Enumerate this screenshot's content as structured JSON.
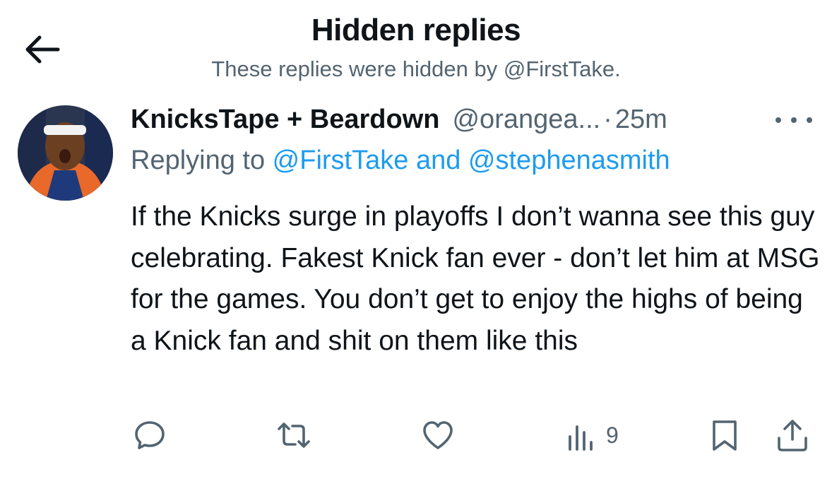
{
  "header": {
    "title": "Hidden replies",
    "subtitle": "These replies were hidden by @FirstTake.",
    "back_icon": "arrow-left-icon"
  },
  "tweet": {
    "display_name": "KnicksTape + Beardown",
    "handle": "@orangea...",
    "separator": "·",
    "time": "25m",
    "replying_prefix": "Replying to ",
    "replying_to_1": "@FirstTake",
    "replying_and": " and ",
    "replying_to_2": "@stephenasmith",
    "text": "If the Knicks surge in playoffs I don’t wanna see this guy celebrating. Fakest Knick fan ever - don’t let him at MSG for the games. You don’t get to enjoy the highs of being a Knick fan and shit on them like this",
    "views": "9"
  },
  "icons": {
    "more": "more-dots-icon",
    "reply": "reply-icon",
    "retweet": "retweet-icon",
    "like": "heart-icon",
    "views": "analytics-icon",
    "bookmark": "bookmark-icon",
    "share": "share-icon"
  },
  "colors": {
    "text": "#0f1419",
    "secondary": "#536471",
    "link": "#1d9bf0",
    "background": "#ffffff"
  }
}
